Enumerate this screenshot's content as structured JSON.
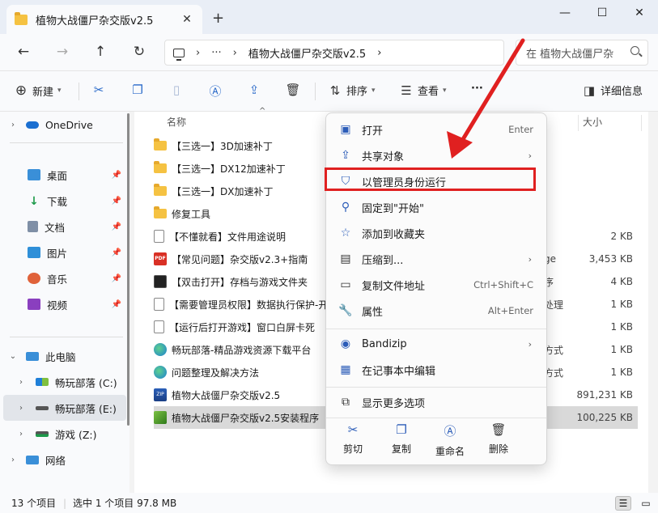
{
  "window": {
    "tab_title": "植物大战僵尸杂交版v2.5",
    "tab_close": "✕",
    "new_tab": "+",
    "minimize": "—",
    "maximize": "☐",
    "close": "✕"
  },
  "nav": {
    "back": "←",
    "forward": "→",
    "up": "↑",
    "refresh": "↻",
    "breadcrumb_more": "···",
    "breadcrumb_sep": "›",
    "breadcrumb_folder": "植物大战僵尸杂交版v2.5",
    "breadcrumb_end": "›",
    "search_placeholder": "在 植物大战僵尸杂"
  },
  "toolbar": {
    "new_label": "新建",
    "sort_label": "排序",
    "view_label": "查看",
    "more_label": "···",
    "details_label": "详细信息"
  },
  "columns": {
    "name": "名称",
    "size": "大小"
  },
  "sidebar": {
    "onedrive": "OneDrive",
    "desktop": "桌面",
    "downloads": "下载",
    "documents": "文档",
    "pictures": "图片",
    "music": "音乐",
    "videos": "视频",
    "this_pc": "此电脑",
    "drive_c": "畅玩部落 (C:)",
    "drive_e": "畅玩部落 (E:)",
    "drive_z": "游戏 (Z:)",
    "network": "网络"
  },
  "files": [
    {
      "name": "【三选一】3D加速补丁",
      "type": "",
      "size": "",
      "icon": "folder-icon"
    },
    {
      "name": "【三选一】DX12加速补丁",
      "type": "",
      "size": "",
      "icon": "folder-icon"
    },
    {
      "name": "【三选一】DX加速补丁",
      "type": "",
      "size": "",
      "icon": "folder-icon"
    },
    {
      "name": "修复工具",
      "type": "",
      "size": "",
      "icon": "folder-icon"
    },
    {
      "name": "【不懂就看】文件用途说明",
      "type": "",
      "size": "2 KB",
      "icon": "text-document-icon"
    },
    {
      "name": "【常见问题】杂交版v2.3+指南",
      "type": "ge",
      "size": "3,453 KB",
      "icon": "pdf-icon"
    },
    {
      "name": "【双击打开】存档与游戏文件夹",
      "type": "序",
      "size": "4 KB",
      "icon": "cmd-icon"
    },
    {
      "name": "【需要管理员权限】数据执行保护-开",
      "type": "处理",
      "size": "1 KB",
      "icon": "cmd-gear-icon"
    },
    {
      "name": "【运行后打开游戏】窗口白屏卡死",
      "type": "",
      "size": "1 KB",
      "icon": "document-icon"
    },
    {
      "name": "畅玩部落-精品游戏资源下载平台",
      "type": "方式",
      "size": "1 KB",
      "icon": "edge-icon"
    },
    {
      "name": "问题整理及解决方法",
      "type": "方式",
      "size": "1 KB",
      "icon": "edge-icon"
    },
    {
      "name": "植物大战僵尸杂交版v2.5",
      "type": "",
      "size": "891,231 KB",
      "icon": "zip-icon"
    },
    {
      "name": "植物大战僵尸杂交版v2.5安装程序",
      "type": "",
      "size": "100,225 KB",
      "icon": "installer-icon"
    }
  ],
  "context_menu": {
    "open": "打开",
    "open_short": "Enter",
    "share": "共享对象",
    "run_as_admin": "以管理员身份运行",
    "pin_start": "固定到\"开始\"",
    "add_favorite": "添加到收藏夹",
    "compress": "压缩到...",
    "copy_path": "复制文件地址",
    "copy_path_short": "Ctrl+Shift+C",
    "properties": "属性",
    "properties_short": "Alt+Enter",
    "bandizip": "Bandizip",
    "edit_notepad": "在记事本中编辑",
    "more_options": "显示更多选项",
    "cut": "剪切",
    "copy": "复制",
    "rename": "重命名",
    "delete": "删除"
  },
  "status": {
    "item_count": "13 个项目",
    "selection": "选中 1 个项目  97.8 MB"
  },
  "colors": {
    "accent": "#2b5cb8",
    "highlight_border": "#e02020",
    "folder": "#f5c242"
  }
}
